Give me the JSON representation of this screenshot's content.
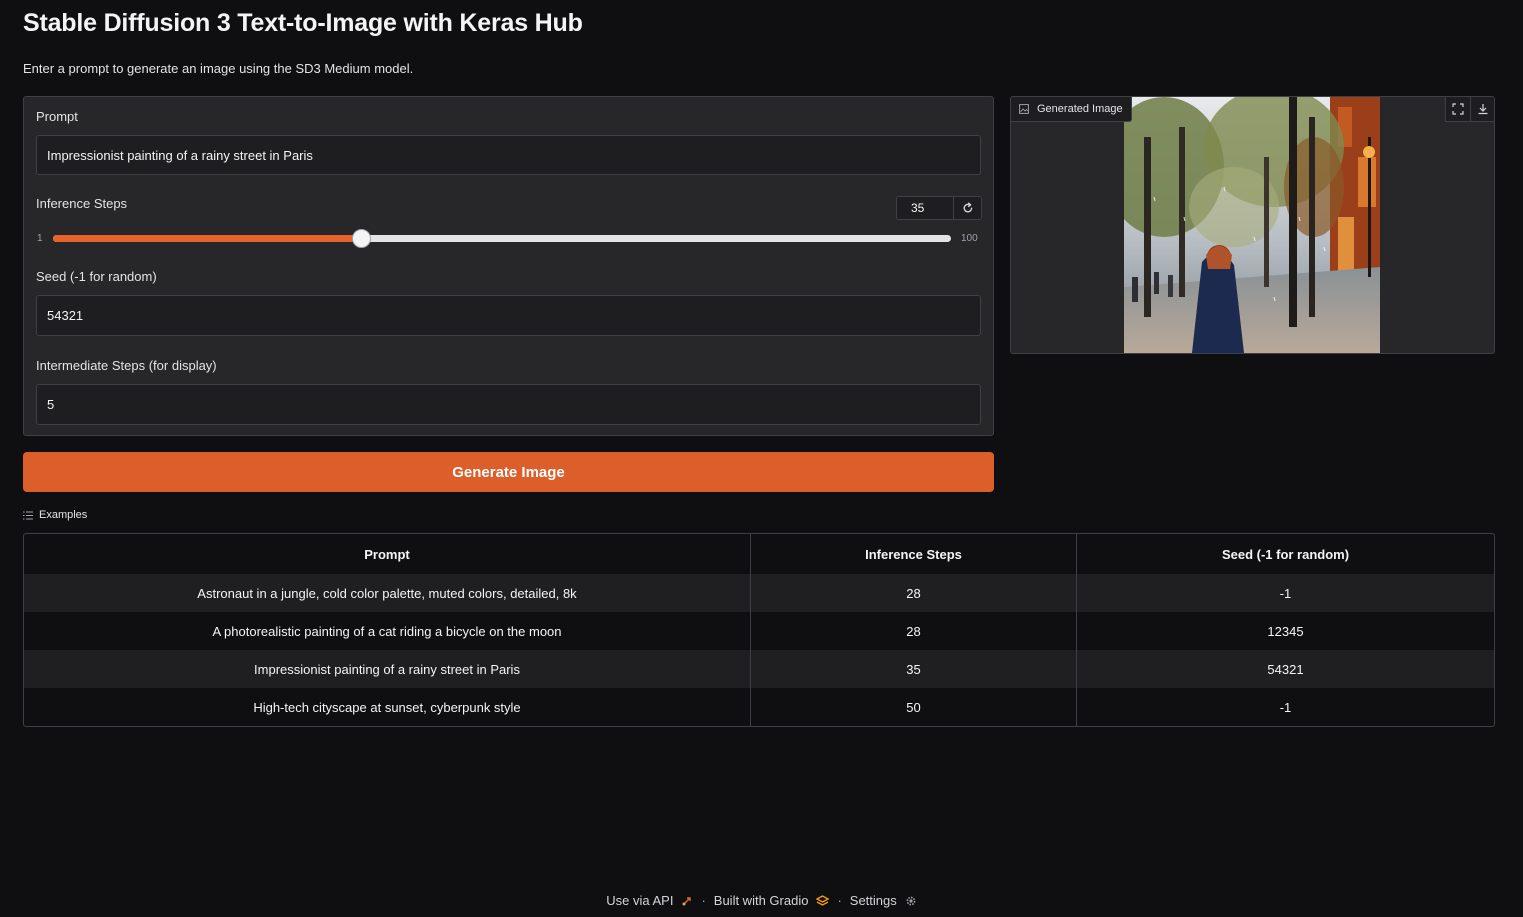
{
  "header": {
    "title": "Stable Diffusion 3 Text-to-Image with Keras Hub",
    "subtitle": "Enter a prompt to generate an image using the SD3 Medium model."
  },
  "form": {
    "prompt_label": "Prompt",
    "prompt_value": "Impressionist painting of a rainy street in Paris",
    "steps_label": "Inference Steps",
    "steps_value": "35",
    "steps_min": "1",
    "steps_max": "100",
    "steps_fraction": 0.3434,
    "seed_label": "Seed (-1 for random)",
    "seed_value": "54321",
    "intermediate_label": "Intermediate Steps (for display)",
    "intermediate_value": "5"
  },
  "generate_button": {
    "label": "Generate Image"
  },
  "output": {
    "label": "Generated Image"
  },
  "examples": {
    "label": "Examples",
    "headers": [
      "Prompt",
      "Inference Steps",
      "Seed (-1 for random)"
    ],
    "rows": [
      [
        "Astronaut in a jungle, cold color palette, muted colors, detailed, 8k",
        "28",
        "-1"
      ],
      [
        "A photorealistic painting of a cat riding a bicycle on the moon",
        "28",
        "12345"
      ],
      [
        "Impressionist painting of a rainy street in Paris",
        "35",
        "54321"
      ],
      [
        "High-tech cityscape at sunset, cyberpunk style",
        "50",
        "-1"
      ]
    ]
  },
  "footer": {
    "api": "Use via API",
    "built": "Built with Gradio",
    "settings": "Settings"
  },
  "colors": {
    "accent": "#dc5e2a",
    "background": "#0f0f11",
    "panel": "#27272a"
  }
}
